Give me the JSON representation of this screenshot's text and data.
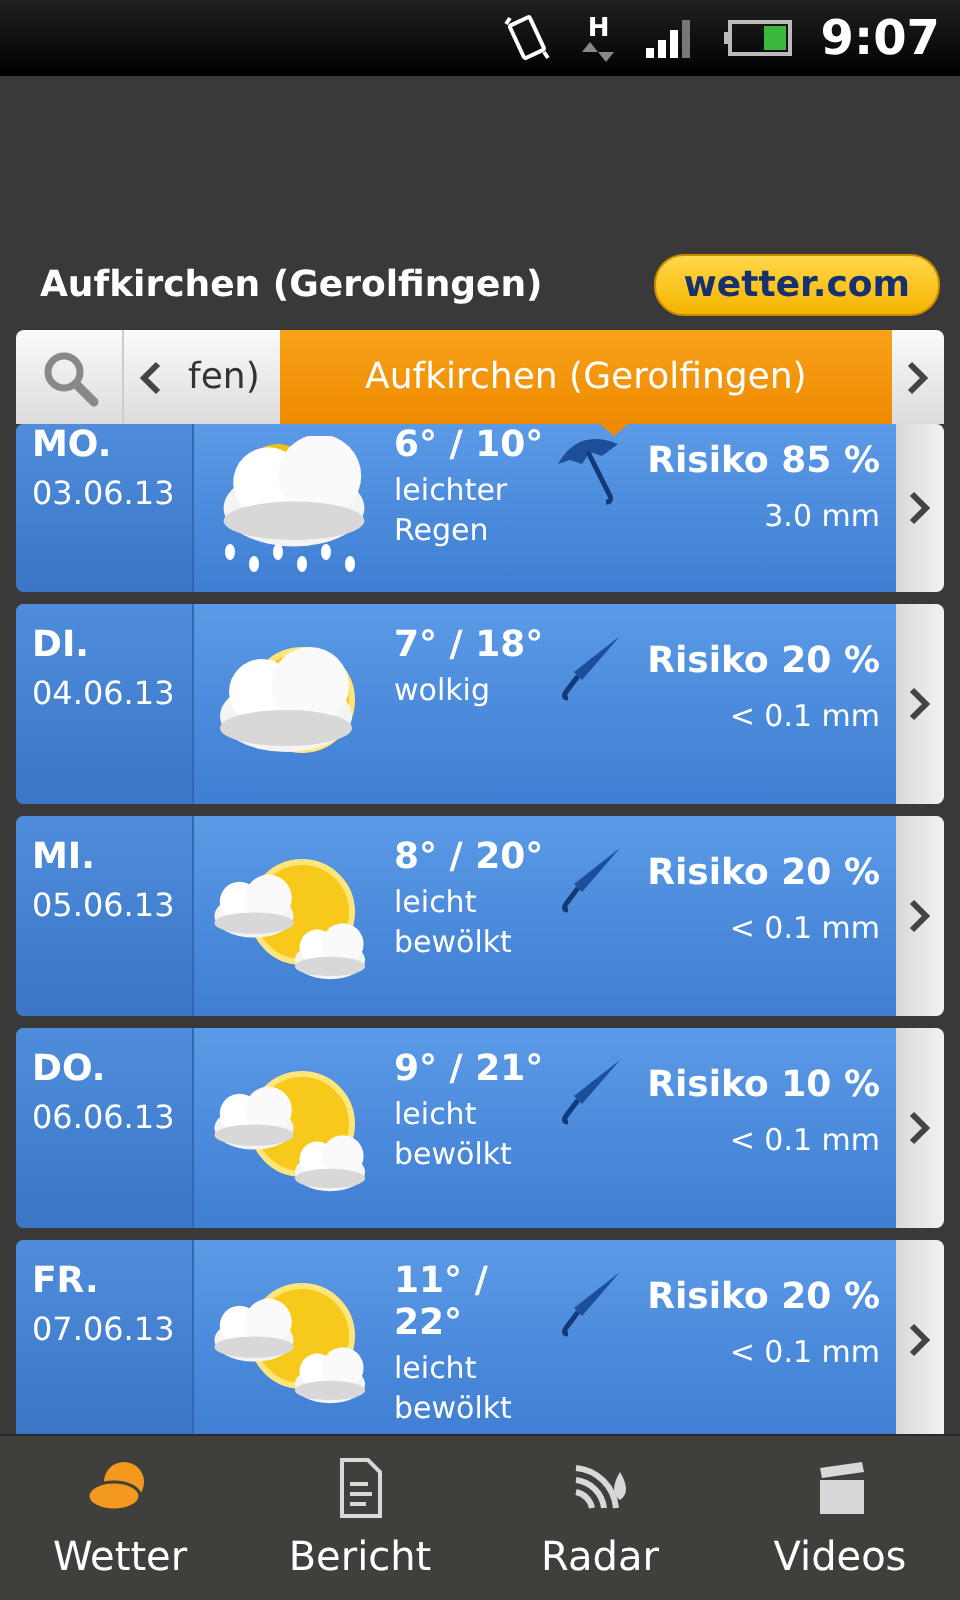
{
  "status_bar": {
    "network": "H",
    "time": "9:07"
  },
  "header": {
    "title": "Aufkirchen (Gerolfingen)",
    "logo": "wetter.com"
  },
  "tabs": [
    {
      "label": "fen)",
      "selected": false
    },
    {
      "label": "Aufkirchen (Gerolfingen)",
      "selected": true
    }
  ],
  "days": [
    {
      "day": "MO.",
      "date": "03.06.13",
      "kind": "rain",
      "temps": "6° / 10°",
      "condition": "leichter Regen",
      "umbrella_open": true,
      "risk": "Risiko 85 %",
      "amount": "3.0 mm"
    },
    {
      "day": "DI.",
      "date": "04.06.13",
      "kind": "cloudy",
      "temps": "7° / 18°",
      "condition": "wolkig",
      "umbrella_open": false,
      "risk": "Risiko 20 %",
      "amount": "< 0.1 mm"
    },
    {
      "day": "MI.",
      "date": "05.06.13",
      "kind": "partly",
      "temps": "8° / 20°",
      "condition": "leicht bewölkt",
      "umbrella_open": false,
      "risk": "Risiko 20 %",
      "amount": "< 0.1 mm"
    },
    {
      "day": "DO.",
      "date": "06.06.13",
      "kind": "partly",
      "temps": "9° / 21°",
      "condition": "leicht bewölkt",
      "umbrella_open": false,
      "risk": "Risiko 10 %",
      "amount": "< 0.1 mm"
    },
    {
      "day": "FR.",
      "date": "07.06.13",
      "kind": "partly",
      "temps": "11° / 22°",
      "condition": "leicht bewölkt",
      "umbrella_open": false,
      "risk": "Risiko 20 %",
      "amount": "< 0.1 mm"
    }
  ],
  "nav": [
    {
      "label": "Wetter",
      "kind": "weather",
      "selected": true
    },
    {
      "label": "Bericht",
      "kind": "report",
      "selected": false
    },
    {
      "label": "Radar",
      "kind": "radar",
      "selected": false
    },
    {
      "label": "Videos",
      "kind": "video",
      "selected": false
    }
  ]
}
